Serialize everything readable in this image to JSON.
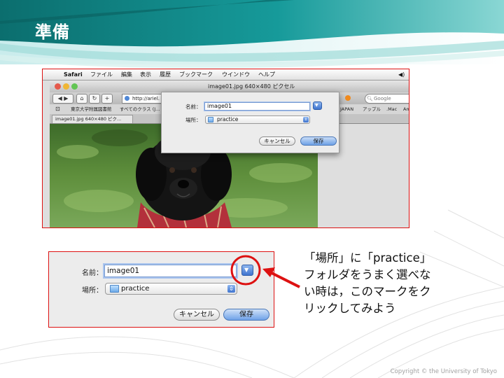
{
  "slide": {
    "title": "準備",
    "copyright": "Copyright © the University of Tokyo",
    "note": "「場所」に「practice」\nフォルダをうまく選べな\nい時は，このマークをク\nリックしてみよう"
  },
  "browser": {
    "menu": {
      "app": "Safari",
      "items": [
        "ファイル",
        "編集",
        "表示",
        "履歴",
        "ブックマーク",
        "ウインドウ",
        "ヘルプ"
      ]
    },
    "window_title": "image01.jpg 640×480 ピクセル",
    "url": "http://ariel.",
    "search_placeholder": "Google",
    "bookmarks": [
      "東京大学附属図書館",
      "すべてのクラス (J...",
      "JAPAN",
      "アップル",
      ".Mac",
      "Am"
    ],
    "tab_label": "image01.jpg 640×480 ピク..."
  },
  "save_sheet": {
    "name_label": "名前：",
    "name_value": "image01",
    "where_label": "場所：",
    "where_value": "practice",
    "cancel_label": "キャンセル",
    "save_label": "保存"
  },
  "colors": {
    "highlight_red": "#dd1111",
    "title_bar_teal": "#0a8a8a"
  }
}
